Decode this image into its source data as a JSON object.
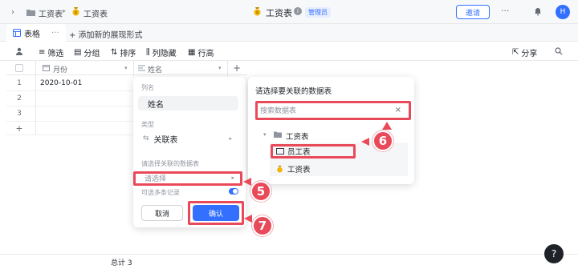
{
  "header": {
    "breadcrumb_1": "工资表",
    "breadcrumb_2": "工资表",
    "doc_title": "工资表",
    "role_badge": "管理员",
    "share_label": "邀请",
    "avatar_letter": "H"
  },
  "tabs": {
    "active_label": "表格",
    "add_view_label": "+ 添加新的展现形式"
  },
  "toolbar": {
    "filter": "筛选",
    "group": "分组",
    "sort": "排序",
    "hide": "列隐藏",
    "row_height": "行高",
    "share": "分享"
  },
  "grid": {
    "columns": [
      "月份",
      "姓名"
    ],
    "rows": [
      {
        "num": "1",
        "month": "2020-10-01"
      },
      {
        "num": "2",
        "month": ""
      },
      {
        "num": "3",
        "month": ""
      }
    ],
    "add_row": "+",
    "total": "总计 3"
  },
  "field_panel": {
    "name_label": "列名",
    "name_value": "姓名",
    "type_label": "类型",
    "type_value": "关联表",
    "choose_table_label": "请选择关联的数据表",
    "choose_placeholder": "请选择",
    "multi_label": "可选多条记录",
    "cancel": "取消",
    "confirm": "确认"
  },
  "table_picker": {
    "title": "请选择要关联的数据表",
    "search_placeholder": "搜索数据表",
    "folder": "工资表",
    "items": [
      "员工表",
      "工资表"
    ]
  },
  "steps": [
    "5",
    "6",
    "7"
  ],
  "help": "?",
  "colors": {
    "accent": "#3370ff",
    "highlight": "#e94a5a"
  }
}
